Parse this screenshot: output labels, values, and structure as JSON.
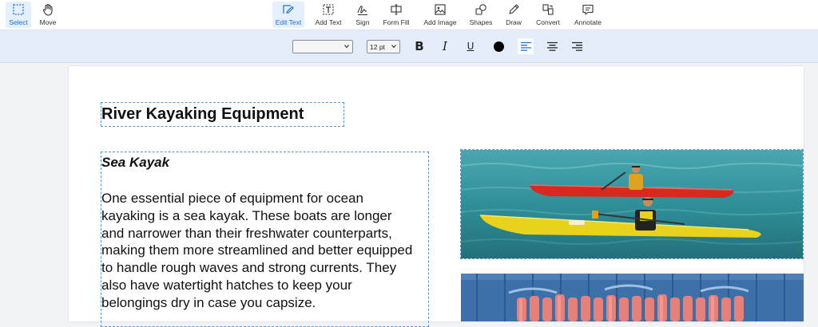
{
  "toolbar": {
    "tools": [
      {
        "label": "Select",
        "icon": "select-icon"
      },
      {
        "label": "Move",
        "icon": "hand-icon"
      },
      {
        "label": "Edit Text",
        "icon": "edit-text-icon"
      },
      {
        "label": "Add Text",
        "icon": "add-text-icon"
      },
      {
        "label": "Sign",
        "icon": "signature-icon"
      },
      {
        "label": "Form Fill",
        "icon": "form-fill-icon"
      },
      {
        "label": "Add Image",
        "icon": "image-icon"
      },
      {
        "label": "Shapes",
        "icon": "shapes-icon"
      },
      {
        "label": "Draw",
        "icon": "pencil-icon"
      },
      {
        "label": "Convert",
        "icon": "convert-icon"
      },
      {
        "label": "Annotate",
        "icon": "comment-icon"
      }
    ],
    "active_color": "#1f6fd6"
  },
  "format_bar": {
    "font_family_value": "",
    "font_size_value": "12 pt",
    "bold_label": "B",
    "italic_label": "I",
    "underline_label": "U",
    "text_color": "#000000",
    "align_options": [
      "align-left-icon",
      "align-center-icon",
      "align-right-icon"
    ],
    "selected_align": "align-left-icon"
  },
  "document": {
    "title": "River Kayaking Equipment",
    "section_title": "Sea Kayak",
    "paragraph_lines": [
      "One essential piece of equipment for ocean",
      "kayaking is a sea kayak. These boats are longer",
      "and narrower than their freshwater counterparts,",
      "making them more streamlined and better equipped",
      "to handle rough waves and strong currents. They",
      "also have watertight hatches to keep your",
      "belongings dry in case you capsize."
    ]
  }
}
